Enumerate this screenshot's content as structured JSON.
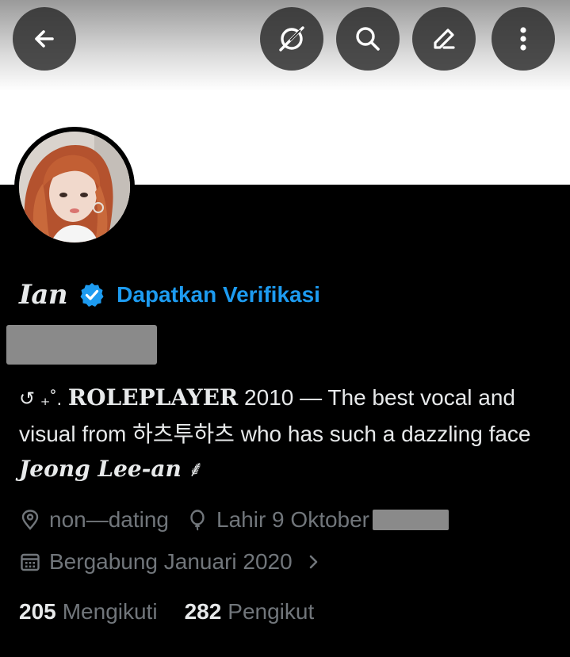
{
  "header": {
    "back_icon": "arrow-left-icon",
    "grok_icon": "grok-icon",
    "search_icon": "search-icon",
    "edit_icon": "edit-icon",
    "more_icon": "more-vertical-icon"
  },
  "profile": {
    "name": "Ian",
    "verified_icon": "verified-badge-icon",
    "get_verified_label": "Dapatkan Verifikasi",
    "bio": {
      "symbols": "↺ ₊˚.",
      "role": "ROLEPLAYER",
      "text_main": " 2010 — The best vocal and visual from 하츠투하츠 who has such a dazzling face ",
      "highlight_name": "Jeong Lee-an",
      "end_symbol": "⸙"
    },
    "location": "non—dating",
    "birthday": "Lahir 9 Oktober",
    "joined": "Bergabung Januari 2020",
    "following_count": "205",
    "following_label": "Mengikuti",
    "followers_count": "282",
    "followers_label": "Pengikut"
  },
  "colors": {
    "accent": "#1d9bf0",
    "text_primary": "#e7e9ea",
    "text_secondary": "#71767b",
    "background": "#000000"
  }
}
